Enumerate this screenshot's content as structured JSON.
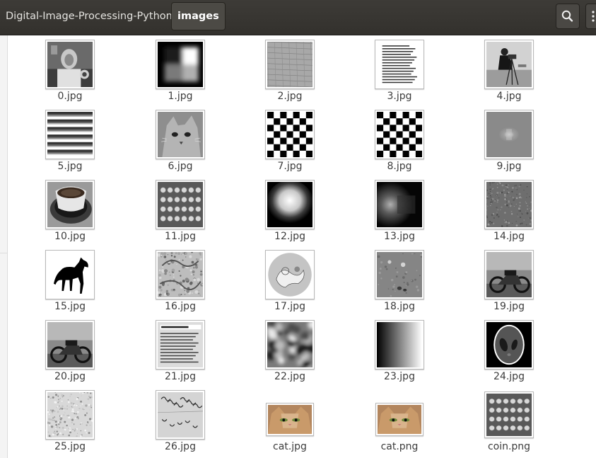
{
  "breadcrumb": {
    "parent": "Digital-Image-Processing-Python",
    "current": "images"
  },
  "toolbar": {
    "search_icon": "search-icon",
    "menu_icon": "menu-icon"
  },
  "files": [
    {
      "name": "0.jpg",
      "icon": "astronaut-photo"
    },
    {
      "name": "1.jpg",
      "icon": "blurred-squares"
    },
    {
      "name": "2.jpg",
      "icon": "brick-texture"
    },
    {
      "name": "3.jpg",
      "icon": "text-page"
    },
    {
      "name": "4.jpg",
      "icon": "cameraman-photo"
    },
    {
      "name": "5.jpg",
      "icon": "horizontal-stripes"
    },
    {
      "name": "6.jpg",
      "icon": "cat-grayscale"
    },
    {
      "name": "7.jpg",
      "icon": "checkerboard"
    },
    {
      "name": "8.jpg",
      "icon": "checkerboard"
    },
    {
      "name": "9.jpg",
      "icon": "blurred-blob"
    },
    {
      "name": "10.jpg",
      "icon": "coffee-cup"
    },
    {
      "name": "11.jpg",
      "icon": "coins-grid"
    },
    {
      "name": "12.jpg",
      "icon": "bright-blob"
    },
    {
      "name": "13.jpg",
      "icon": "dark-gradient-blob"
    },
    {
      "name": "14.jpg",
      "icon": "grass-texture"
    },
    {
      "name": "15.jpg",
      "icon": "horse-silhouette"
    },
    {
      "name": "16.jpg",
      "icon": "cell-texture"
    },
    {
      "name": "17.jpg",
      "icon": "circle-diagram"
    },
    {
      "name": "18.jpg",
      "icon": "moon-surface"
    },
    {
      "name": "19.jpg",
      "icon": "motorcycle-photo"
    },
    {
      "name": "20.jpg",
      "icon": "motorcycle-photo"
    },
    {
      "name": "21.jpg",
      "icon": "text-page-photo"
    },
    {
      "name": "22.jpg",
      "icon": "blur-noise"
    },
    {
      "name": "23.jpg",
      "icon": "horizontal-gradient"
    },
    {
      "name": "24.jpg",
      "icon": "shepp-logan-phantom"
    },
    {
      "name": "25.jpg",
      "icon": "rough-texture"
    },
    {
      "name": "26.jpg",
      "icon": "handwriting-photo"
    },
    {
      "name": "cat.jpg",
      "icon": "cat-color"
    },
    {
      "name": "cat.png",
      "icon": "cat-color"
    },
    {
      "name": "coin.png",
      "icon": "coins-grid"
    }
  ]
}
